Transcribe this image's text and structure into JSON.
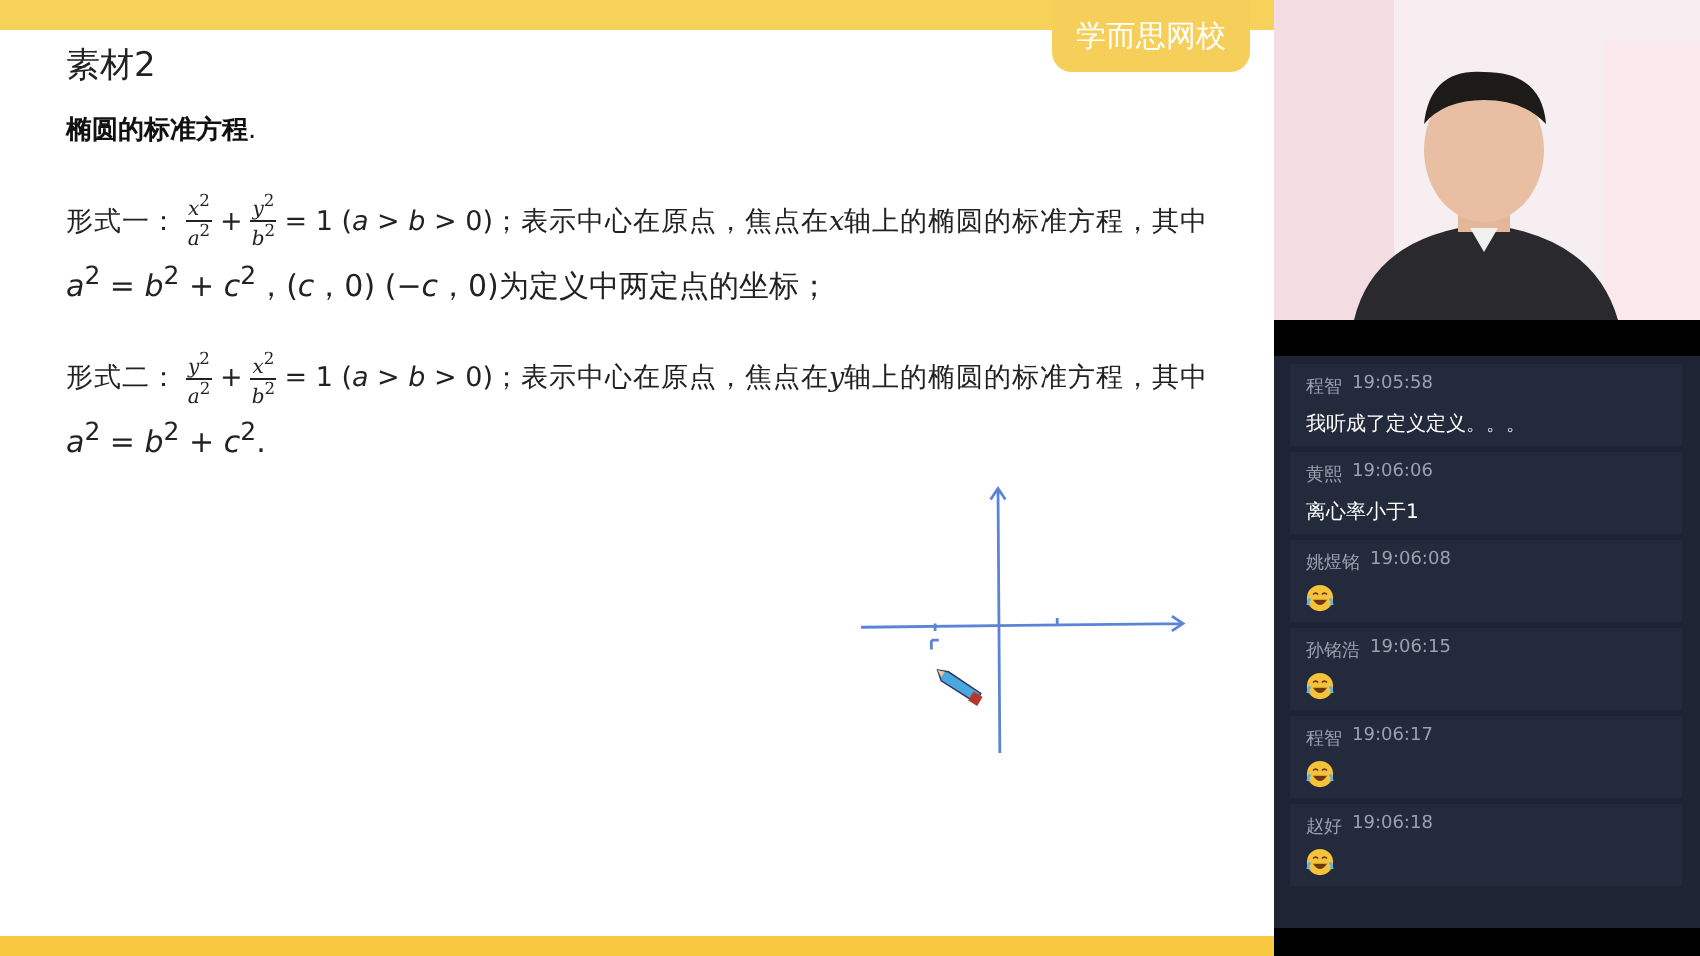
{
  "slide": {
    "logo": "学而思网校",
    "title": "素材2",
    "heading": "**椭圆的标准方程**.",
    "forms": [
      {
        "line1": [
          {
            "kind": "text",
            "text": "形式一："
          },
          {
            "kind": "frac",
            "num": "*x*$^{2}$",
            "den": "*a*$^{2}$"
          },
          {
            "kind": "text",
            "text": "+"
          },
          {
            "kind": "frac",
            "num": "*y*$^{2}$",
            "den": "*b*$^{2}$"
          },
          {
            "kind": "text",
            "text": "= 1 (*a* > *b* > 0)；表示中心在原点，焦点在"
          },
          {
            "kind": "var",
            "text": "x"
          },
          {
            "kind": "text",
            "text": "轴上的椭圆的标准方程，其中"
          }
        ],
        "line2": "*a*$^{2}$ = *b*$^{2}$ + *c*$^{2}$，(*c*，0) (−*c*，0)为定义中两定点的坐标；"
      },
      {
        "line1": [
          {
            "kind": "text",
            "text": "形式二："
          },
          {
            "kind": "frac",
            "num": "*y*$^{2}$",
            "den": "*a*$^{2}$"
          },
          {
            "kind": "text",
            "text": "+"
          },
          {
            "kind": "frac",
            "num": "*x*$^{2}$",
            "den": "*b*$^{2}$"
          },
          {
            "kind": "text",
            "text": "= 1 (*a* > *b* > 0)；表示中心在原点，焦点在"
          },
          {
            "kind": "var",
            "text": "y"
          },
          {
            "kind": "text",
            "text": "轴上的椭圆的标准方程，其中"
          }
        ],
        "line2": "*a*$^{2}$ = *b*$^{2}$ + *c*$^{2}$."
      }
    ]
  },
  "chat": [
    {
      "name": "程智",
      "time": "19:05:58",
      "kind": "text",
      "text": "我听成了定义定义。。。"
    },
    {
      "name": "黄熙",
      "time": "19:06:06",
      "kind": "text",
      "text": "离心率小于1"
    },
    {
      "name": "姚煜铭",
      "time": "19:06:08",
      "kind": "emoji"
    },
    {
      "name": "孙铭浩",
      "time": "19:06:15",
      "kind": "emoji"
    },
    {
      "name": "程智",
      "time": "19:06:17",
      "kind": "emoji"
    },
    {
      "name": "赵好",
      "time": "19:06:18",
      "kind": "emoji"
    }
  ]
}
